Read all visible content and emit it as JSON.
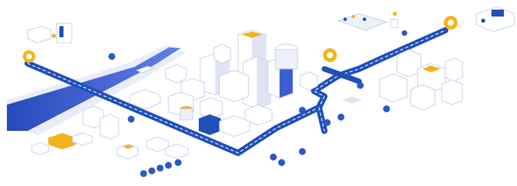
{
  "scene": {
    "kind": "isometric-city-illustration",
    "colors": {
      "road": "#1f4fb8",
      "road_dash": "#ffffff",
      "river": "#2c4fd6",
      "building_light": "#ffffff",
      "building_shade": "#dfe3f4",
      "building_dark": "#c4cbe8",
      "accent_yellow": "#f2b21b",
      "tree": "#2d56c9",
      "pin": "#f4b41a"
    },
    "location_pins": 4,
    "icons": [
      "location-pin-icon",
      "tree-icon",
      "boat-icon",
      "desk-icon",
      "meeting-room-icon",
      "workstation-icon"
    ]
  }
}
